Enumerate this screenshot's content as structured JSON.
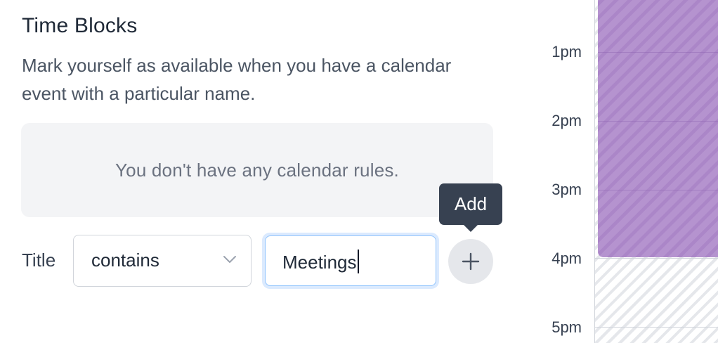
{
  "section": {
    "title": "Time Blocks",
    "description": "Mark yourself as available when you have a calendar event with a particular name."
  },
  "rules": {
    "empty_message": "You don't have any calendar rules."
  },
  "rule_form": {
    "field_label": "Title",
    "operator_value": "contains",
    "text_value": "Meetings",
    "add_icon": "plus-icon",
    "add_tooltip": "Add"
  },
  "calendar": {
    "time_labels": [
      "1pm",
      "2pm",
      "3pm",
      "4pm",
      "5pm"
    ],
    "event_color": "#b593cf"
  },
  "colors": {
    "tooltip_bg": "#374151",
    "focus_ring": "#93c5fd",
    "empty_box_bg": "#f3f4f6"
  }
}
